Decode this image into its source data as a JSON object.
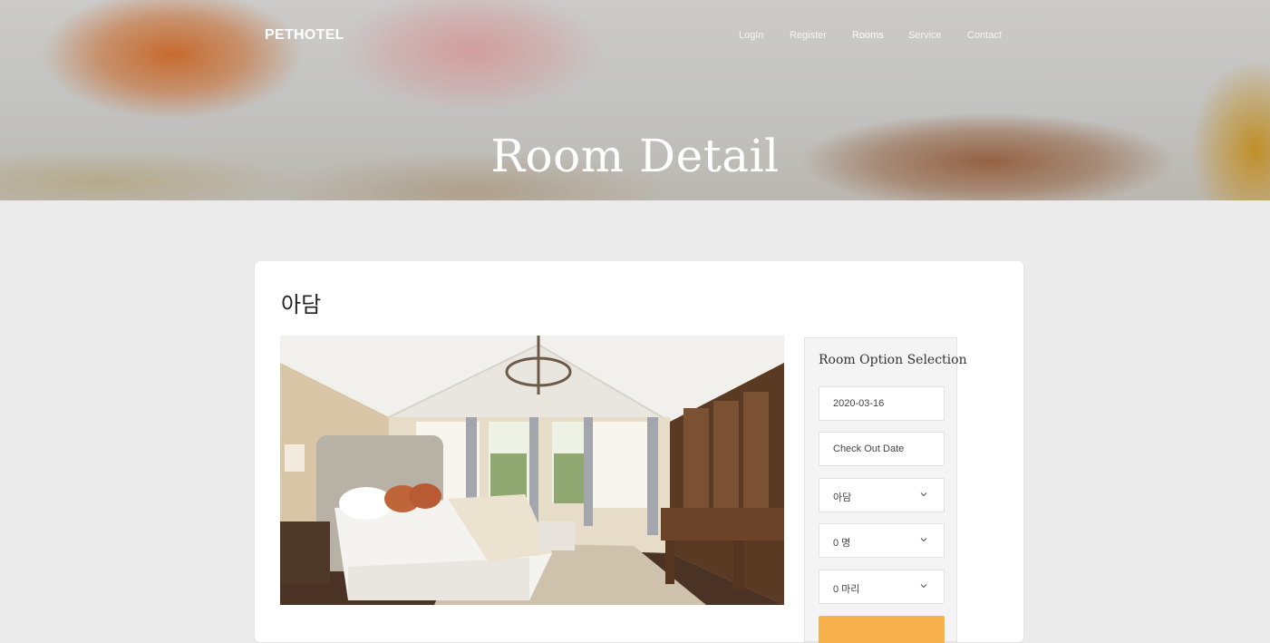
{
  "brand": "PETHOTEL",
  "nav": {
    "login": "LogIn",
    "register": "Register",
    "rooms": "Rooms",
    "service": "Service",
    "contact": "Contact"
  },
  "hero": {
    "title": "Room Detail"
  },
  "room": {
    "name": "아담"
  },
  "booking": {
    "title": "Room Option Selection",
    "check_in": "2020-03-16",
    "check_out_placeholder": "Check Out Date",
    "room_select": "아담",
    "people_select": "0 명",
    "pets_select": "0 마리"
  },
  "colors": {
    "accent": "#f8b24d",
    "page_bg": "#ebebeb"
  }
}
